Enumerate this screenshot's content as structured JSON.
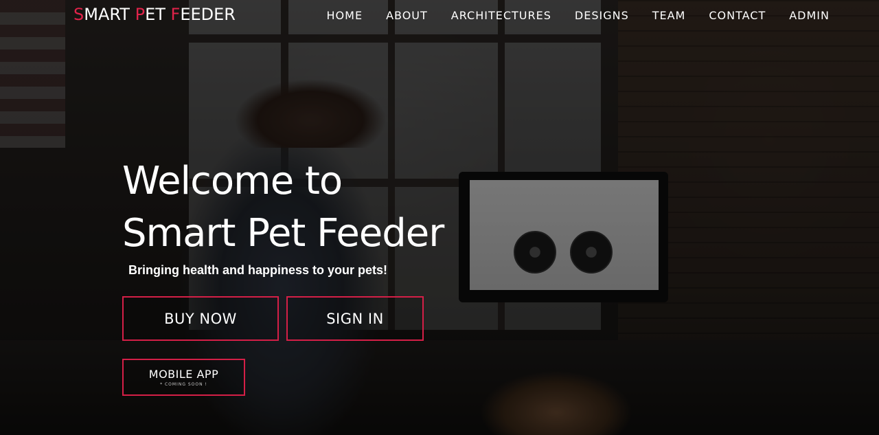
{
  "brand": {
    "logo_parts": [
      {
        "text": "S",
        "accent": true
      },
      {
        "text": "MART ",
        "accent": false
      },
      {
        "text": "P",
        "accent": true
      },
      {
        "text": "ET ",
        "accent": false
      },
      {
        "text": "F",
        "accent": true
      },
      {
        "text": "EEDER",
        "accent": false
      }
    ],
    "accent_color": "#e0234a"
  },
  "nav": {
    "items": [
      "HOME",
      "ABOUT",
      "ARCHITECTURES",
      "DESIGNS",
      "TEAM",
      "CONTACT",
      "ADMIN"
    ]
  },
  "hero": {
    "headline_line1": "Welcome to",
    "headline_line2": "Smart Pet Feeder",
    "tagline": "Bringing health and happiness to your pets!",
    "buy_label": "BUY NOW",
    "signin_label": "SIGN IN",
    "mobile_label": "MOBILE APP",
    "mobile_sublabel": "* COMING SOON !",
    "button_border_color": "#d51f47"
  }
}
